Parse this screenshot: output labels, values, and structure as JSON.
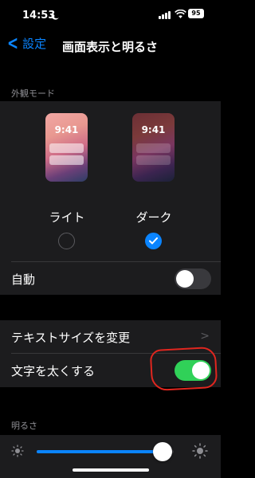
{
  "status_bar": {
    "time": "14:53",
    "battery": "95"
  },
  "nav": {
    "back_label": "設定",
    "title": "画面表示と明るさ"
  },
  "appearance": {
    "header": "外観モード",
    "preview_time": "9:41",
    "light_label": "ライト",
    "dark_label": "ダーク",
    "selected": "dark",
    "auto_label": "自動",
    "auto_enabled": false
  },
  "text_settings": {
    "text_size_label": "テキストサイズを変更",
    "bold_text_label": "文字を太くする",
    "bold_text_enabled": true
  },
  "brightness": {
    "header": "明るさ",
    "level": 0.92
  },
  "colors": {
    "accent": "#0a84ff",
    "toggle_on": "#30d158",
    "annotation": "#e0261f"
  }
}
